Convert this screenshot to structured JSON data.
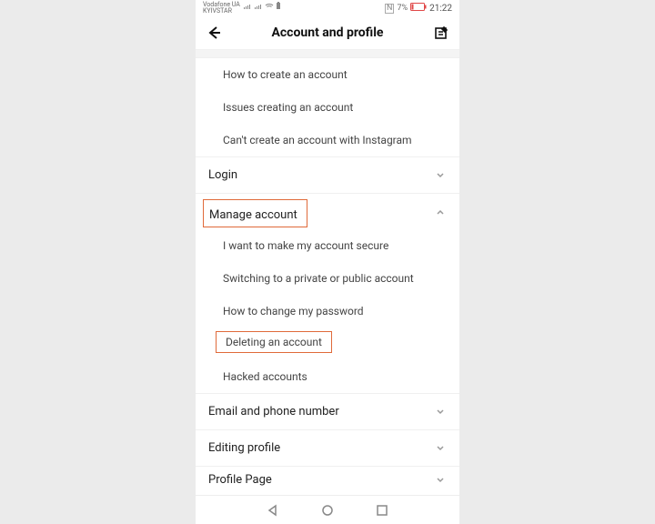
{
  "status": {
    "carrier1": "Vodafone UA",
    "carrier2": "KYIVSTAR",
    "nfc": "N",
    "battery_pct": "7%",
    "time": "21:22"
  },
  "header": {
    "title": "Account and profile"
  },
  "sections": {
    "creating_items": [
      "How to create an account",
      "Issues creating an account",
      "Can't create an account with Instagram"
    ],
    "login": {
      "label": "Login"
    },
    "manage_account": {
      "label": "Manage account",
      "items": [
        "I want to make my account secure",
        "Switching to a private or public account",
        "How to change my password",
        "Deleting an account",
        "Hacked accounts"
      ]
    },
    "email_phone": {
      "label": "Email and phone number"
    },
    "editing_profile": {
      "label": "Editing profile"
    },
    "profile_page": {
      "label": "Profile Page"
    }
  }
}
